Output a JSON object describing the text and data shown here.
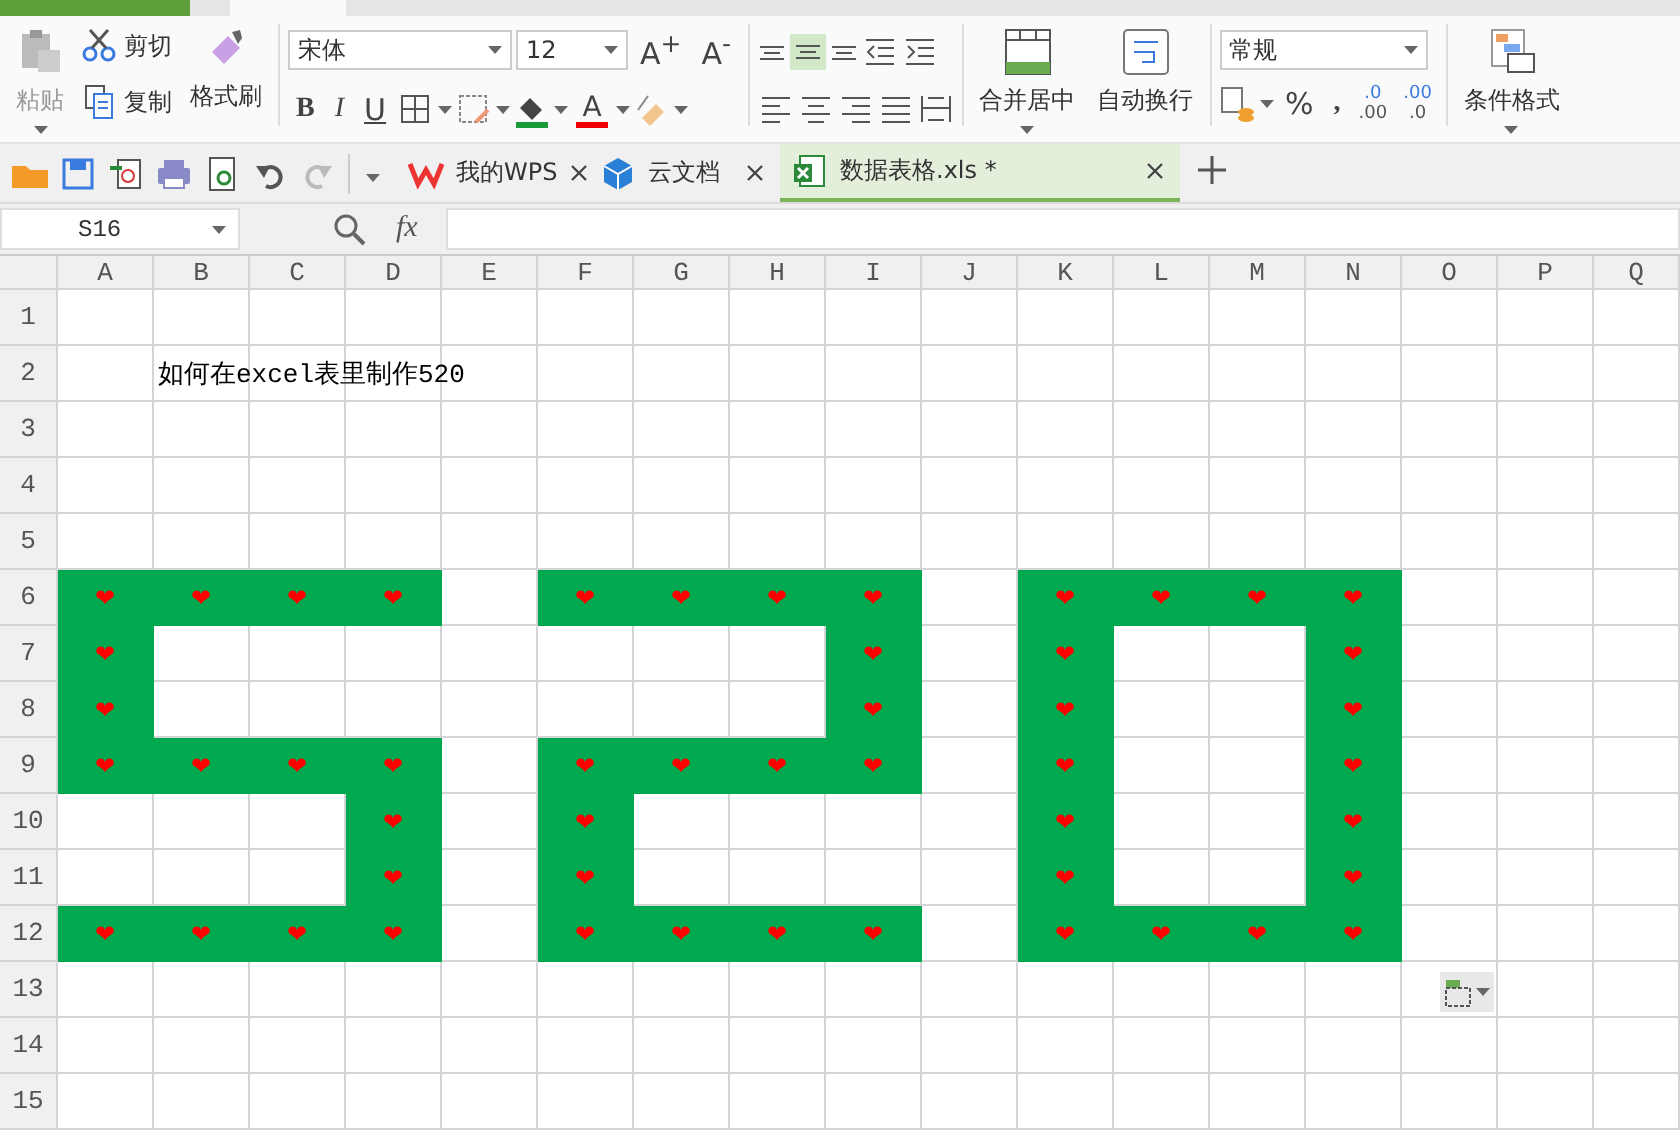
{
  "ribbon": {
    "paste": "粘贴",
    "cut": "剪切",
    "copy": "复制",
    "format_painter": "格式刷",
    "font_name": "宋体",
    "font_size": "12",
    "grow_font": "A$^{+}$",
    "shrink_font": "A$^{-}$",
    "bold": "B",
    "italic": "I",
    "underline": "U",
    "font_color": "A",
    "merge_center": "合并居中",
    "wrap_text": "自动换行",
    "number_format": "常规",
    "percent": "%",
    "comma": ",",
    "decimal_buttons": [
      {
        "top": ".0",
        "bottom": ".00"
      },
      {
        "top": ".00",
        "bottom": ".0"
      }
    ],
    "conditional_format": "条件格式"
  },
  "doc_tabs": [
    {
      "label": "我的WPS",
      "kind": "wps",
      "selected": false
    },
    {
      "label": "云文档",
      "kind": "cloud",
      "selected": false
    },
    {
      "label": "数据表格.xls *",
      "kind": "sheet",
      "selected": true
    }
  ],
  "formula_bar": {
    "cell_name": "S16",
    "fx": "fx"
  },
  "columns": [
    "A",
    "B",
    "C",
    "D",
    "E",
    "F",
    "G",
    "H",
    "I",
    "J",
    "K",
    "L",
    "M",
    "N",
    "O",
    "P",
    "Q"
  ],
  "rows": [
    {
      "header": "1",
      "cells": [
        {
          "filled": false
        },
        {
          "filled": false
        },
        {
          "filled": false
        },
        {
          "filled": false
        },
        {
          "filled": false
        },
        {
          "filled": false
        },
        {
          "filled": false
        },
        {
          "filled": false
        },
        {
          "filled": false
        },
        {
          "filled": false
        },
        {
          "filled": false
        },
        {
          "filled": false
        },
        {
          "filled": false
        },
        {
          "filled": false
        },
        {
          "filled": false
        },
        {
          "filled": false
        },
        {
          "filled": false
        }
      ]
    },
    {
      "header": "2",
      "cells": [
        {
          "filled": false
        },
        {
          "filled": false,
          "text": "如何在excel表里制作520"
        },
        {
          "filled": false
        },
        {
          "filled": false
        },
        {
          "filled": false
        },
        {
          "filled": false
        },
        {
          "filled": false
        },
        {
          "filled": false
        },
        {
          "filled": false
        },
        {
          "filled": false
        },
        {
          "filled": false
        },
        {
          "filled": false
        },
        {
          "filled": false
        },
        {
          "filled": false
        },
        {
          "filled": false
        },
        {
          "filled": false
        },
        {
          "filled": false
        }
      ]
    },
    {
      "header": "3",
      "cells": [
        {
          "filled": false
        },
        {
          "filled": false
        },
        {
          "filled": false
        },
        {
          "filled": false
        },
        {
          "filled": false
        },
        {
          "filled": false
        },
        {
          "filled": false
        },
        {
          "filled": false
        },
        {
          "filled": false
        },
        {
          "filled": false
        },
        {
          "filled": false
        },
        {
          "filled": false
        },
        {
          "filled": false
        },
        {
          "filled": false
        },
        {
          "filled": false
        },
        {
          "filled": false
        },
        {
          "filled": false
        }
      ]
    },
    {
      "header": "4",
      "cells": [
        {
          "filled": false
        },
        {
          "filled": false
        },
        {
          "filled": false
        },
        {
          "filled": false
        },
        {
          "filled": false
        },
        {
          "filled": false
        },
        {
          "filled": false
        },
        {
          "filled": false
        },
        {
          "filled": false
        },
        {
          "filled": false
        },
        {
          "filled": false
        },
        {
          "filled": false
        },
        {
          "filled": false
        },
        {
          "filled": false
        },
        {
          "filled": false
        },
        {
          "filled": false
        },
        {
          "filled": false
        }
      ]
    },
    {
      "header": "5",
      "cells": [
        {
          "filled": false
        },
        {
          "filled": false
        },
        {
          "filled": false
        },
        {
          "filled": false
        },
        {
          "filled": false
        },
        {
          "filled": false
        },
        {
          "filled": false
        },
        {
          "filled": false
        },
        {
          "filled": false
        },
        {
          "filled": false
        },
        {
          "filled": false
        },
        {
          "filled": false
        },
        {
          "filled": false
        },
        {
          "filled": false
        },
        {
          "filled": false
        },
        {
          "filled": false
        },
        {
          "filled": false
        }
      ]
    },
    {
      "header": "6",
      "cells": [
        {
          "filled": true,
          "text": "❤"
        },
        {
          "filled": true,
          "text": "❤"
        },
        {
          "filled": true,
          "text": "❤"
        },
        {
          "filled": true,
          "text": "❤"
        },
        {
          "filled": false
        },
        {
          "filled": true,
          "text": "❤"
        },
        {
          "filled": true,
          "text": "❤"
        },
        {
          "filled": true,
          "text": "❤"
        },
        {
          "filled": true,
          "text": "❤"
        },
        {
          "filled": false
        },
        {
          "filled": true,
          "text": "❤"
        },
        {
          "filled": true,
          "text": "❤"
        },
        {
          "filled": true,
          "text": "❤"
        },
        {
          "filled": true,
          "text": "❤"
        },
        {
          "filled": false
        },
        {
          "filled": false
        },
        {
          "filled": false
        }
      ]
    },
    {
      "header": "7",
      "cells": [
        {
          "filled": true,
          "text": "❤"
        },
        {
          "filled": false
        },
        {
          "filled": false
        },
        {
          "filled": false
        },
        {
          "filled": false
        },
        {
          "filled": false
        },
        {
          "filled": false
        },
        {
          "filled": false
        },
        {
          "filled": true,
          "text": "❤"
        },
        {
          "filled": false
        },
        {
          "filled": true,
          "text": "❤"
        },
        {
          "filled": false
        },
        {
          "filled": false
        },
        {
          "filled": true,
          "text": "❤"
        },
        {
          "filled": false
        },
        {
          "filled": false
        },
        {
          "filled": false
        }
      ]
    },
    {
      "header": "8",
      "cells": [
        {
          "filled": true,
          "text": "❤"
        },
        {
          "filled": false
        },
        {
          "filled": false
        },
        {
          "filled": false
        },
        {
          "filled": false
        },
        {
          "filled": false
        },
        {
          "filled": false
        },
        {
          "filled": false
        },
        {
          "filled": true,
          "text": "❤"
        },
        {
          "filled": false
        },
        {
          "filled": true,
          "text": "❤"
        },
        {
          "filled": false
        },
        {
          "filled": false
        },
        {
          "filled": true,
          "text": "❤"
        },
        {
          "filled": false
        },
        {
          "filled": false
        },
        {
          "filled": false
        }
      ]
    },
    {
      "header": "9",
      "cells": [
        {
          "filled": true,
          "text": "❤"
        },
        {
          "filled": true,
          "text": "❤"
        },
        {
          "filled": true,
          "text": "❤"
        },
        {
          "filled": true,
          "text": "❤"
        },
        {
          "filled": false
        },
        {
          "filled": true,
          "text": "❤"
        },
        {
          "filled": true,
          "text": "❤"
        },
        {
          "filled": true,
          "text": "❤"
        },
        {
          "filled": true,
          "text": "❤"
        },
        {
          "filled": false
        },
        {
          "filled": true,
          "text": "❤"
        },
        {
          "filled": false
        },
        {
          "filled": false
        },
        {
          "filled": true,
          "text": "❤"
        },
        {
          "filled": false
        },
        {
          "filled": false
        },
        {
          "filled": false
        }
      ]
    },
    {
      "header": "10",
      "cells": [
        {
          "filled": false
        },
        {
          "filled": false
        },
        {
          "filled": false
        },
        {
          "filled": true,
          "text": "❤"
        },
        {
          "filled": false
        },
        {
          "filled": true,
          "text": "❤"
        },
        {
          "filled": false
        },
        {
          "filled": false
        },
        {
          "filled": false
        },
        {
          "filled": false
        },
        {
          "filled": true,
          "text": "❤"
        },
        {
          "filled": false
        },
        {
          "filled": false
        },
        {
          "filled": true,
          "text": "❤"
        },
        {
          "filled": false
        },
        {
          "filled": false
        },
        {
          "filled": false
        }
      ]
    },
    {
      "header": "11",
      "cells": [
        {
          "filled": false
        },
        {
          "filled": false
        },
        {
          "filled": false
        },
        {
          "filled": true,
          "text": "❤"
        },
        {
          "filled": false
        },
        {
          "filled": true,
          "text": "❤"
        },
        {
          "filled": false
        },
        {
          "filled": false
        },
        {
          "filled": false
        },
        {
          "filled": false
        },
        {
          "filled": true,
          "text": "❤"
        },
        {
          "filled": false
        },
        {
          "filled": false
        },
        {
          "filled": true,
          "text": "❤"
        },
        {
          "filled": false
        },
        {
          "filled": false
        },
        {
          "filled": false
        }
      ]
    },
    {
      "header": "12",
      "cells": [
        {
          "filled": true,
          "text": "❤"
        },
        {
          "filled": true,
          "text": "❤"
        },
        {
          "filled": true,
          "text": "❤"
        },
        {
          "filled": true,
          "text": "❤"
        },
        {
          "filled": false
        },
        {
          "filled": true,
          "text": "❤"
        },
        {
          "filled": true,
          "text": "❤"
        },
        {
          "filled": true,
          "text": "❤"
        },
        {
          "filled": true,
          "text": "❤"
        },
        {
          "filled": false
        },
        {
          "filled": true,
          "text": "❤"
        },
        {
          "filled": true,
          "text": "❤"
        },
        {
          "filled": true,
          "text": "❤"
        },
        {
          "filled": true,
          "text": "❤"
        },
        {
          "filled": false
        },
        {
          "filled": false
        },
        {
          "filled": false
        }
      ]
    },
    {
      "header": "13",
      "cells": [
        {
          "filled": false
        },
        {
          "filled": false
        },
        {
          "filled": false
        },
        {
          "filled": false
        },
        {
          "filled": false
        },
        {
          "filled": false
        },
        {
          "filled": false
        },
        {
          "filled": false
        },
        {
          "filled": false
        },
        {
          "filled": false
        },
        {
          "filled": false
        },
        {
          "filled": false
        },
        {
          "filled": false
        },
        {
          "filled": false
        },
        {
          "filled": false
        },
        {
          "filled": false
        },
        {
          "filled": false
        }
      ]
    },
    {
      "header": "14",
      "cells": [
        {
          "filled": false
        },
        {
          "filled": false
        },
        {
          "filled": false
        },
        {
          "filled": false
        },
        {
          "filled": false
        },
        {
          "filled": false
        },
        {
          "filled": false
        },
        {
          "filled": false
        },
        {
          "filled": false
        },
        {
          "filled": false
        },
        {
          "filled": false
        },
        {
          "filled": false
        },
        {
          "filled": false
        },
        {
          "filled": false
        },
        {
          "filled": false
        },
        {
          "filled": false
        },
        {
          "filled": false
        }
      ]
    },
    {
      "header": "15",
      "cells": [
        {
          "filled": false
        },
        {
          "filled": false
        },
        {
          "filled": false
        },
        {
          "filled": false
        },
        {
          "filled": false
        },
        {
          "filled": false
        },
        {
          "filled": false
        },
        {
          "filled": false
        },
        {
          "filled": false
        },
        {
          "filled": false
        },
        {
          "filled": false
        },
        {
          "filled": false
        },
        {
          "filled": false
        },
        {
          "filled": false
        },
        {
          "filled": false
        },
        {
          "filled": false
        },
        {
          "filled": false
        }
      ]
    }
  ]
}
